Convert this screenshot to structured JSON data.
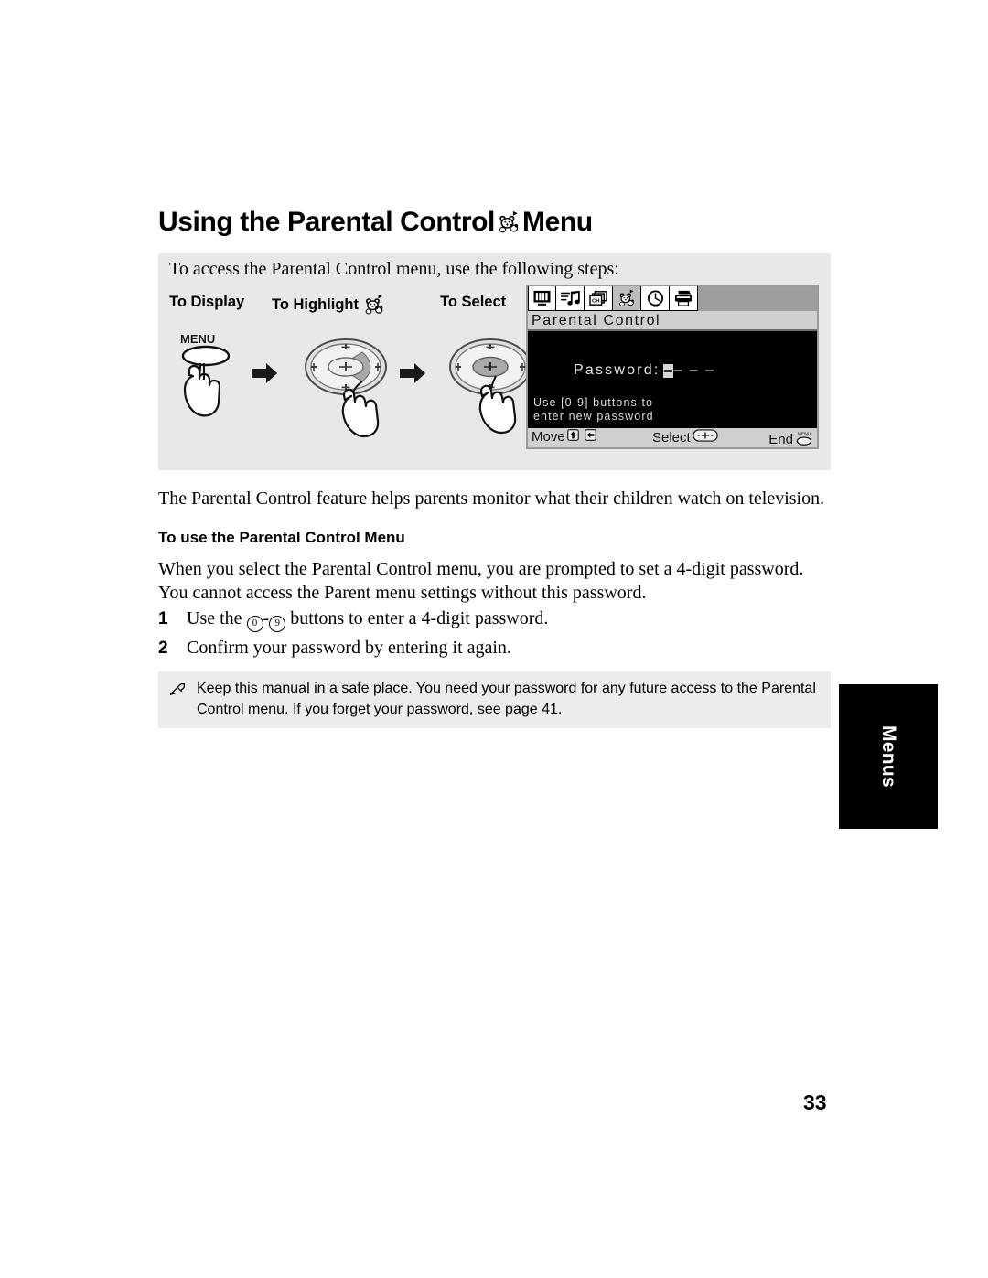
{
  "page": {
    "heading_part1": "Using the Parental Control",
    "heading_icon": "bear-parental-icon",
    "heading_part2": "Menu",
    "page_number": "33",
    "side_tab_label": "Menus"
  },
  "instruction_panel": {
    "intro": "To access the Parental Control menu, use the following steps:",
    "labels": {
      "display": "To Display",
      "highlight": "To Highlight",
      "highlight_icon": "bear-parental-icon",
      "select": "To Select"
    },
    "menu_button_label": "MENU",
    "arrow_icon": "right-arrow-icon"
  },
  "tv_screen": {
    "icons": [
      {
        "name": "video-icon",
        "selected": false
      },
      {
        "name": "audio-icon",
        "selected": false
      },
      {
        "name": "channel-icon",
        "selected": false
      },
      {
        "name": "parental-bear-icon",
        "selected": true
      },
      {
        "name": "timer-clock-icon",
        "selected": false
      },
      {
        "name": "setup-printer-icon",
        "selected": false
      }
    ],
    "title": "Parental Control",
    "password_label": "Password:",
    "password_dashes": "– – –",
    "hint_line1": "Use [0-9] buttons to",
    "hint_line2": "enter new password",
    "footer": {
      "move": "Move",
      "move_icon_up": "up-arrow-key-icon",
      "move_icon_left": "left-arrow-key-icon",
      "select": "Select",
      "select_icon": "center-select-key-icon",
      "end": "End",
      "end_icon": "menu-button-icon",
      "end_icon_label": "MENU"
    }
  },
  "content": {
    "intro_paragraph": "The Parental Control feature helps parents monitor what their children watch on television.",
    "sub_heading": "To use the Parental Control Menu",
    "description": "When you select the Parental Control menu, you are prompted to set a 4-digit password. You cannot access the Parent menu settings without this password.",
    "steps": [
      {
        "number": "1",
        "text_before": "Use the",
        "key_low": "0",
        "key_sep": "-",
        "key_high": "9",
        "text_after": "buttons to enter a 4-digit password."
      },
      {
        "number": "2",
        "text_before": "Confirm your password by entering it again.",
        "key_low": "",
        "key_sep": "",
        "key_high": "",
        "text_after": ""
      }
    ]
  },
  "note": {
    "icon": "pencil-note-icon",
    "text": "Keep this manual in a safe place. You need your password for any future access to the Parental Control menu. If you forget your password, see page 41."
  },
  "colors": {
    "panel_bg": "#e8e8e8",
    "note_bg": "#ececec",
    "tv_bg": "#000000",
    "tv_titlebar": "#cfcfcf",
    "tv_iconbar": "#9e9e9e",
    "side_tab": "#000000"
  }
}
